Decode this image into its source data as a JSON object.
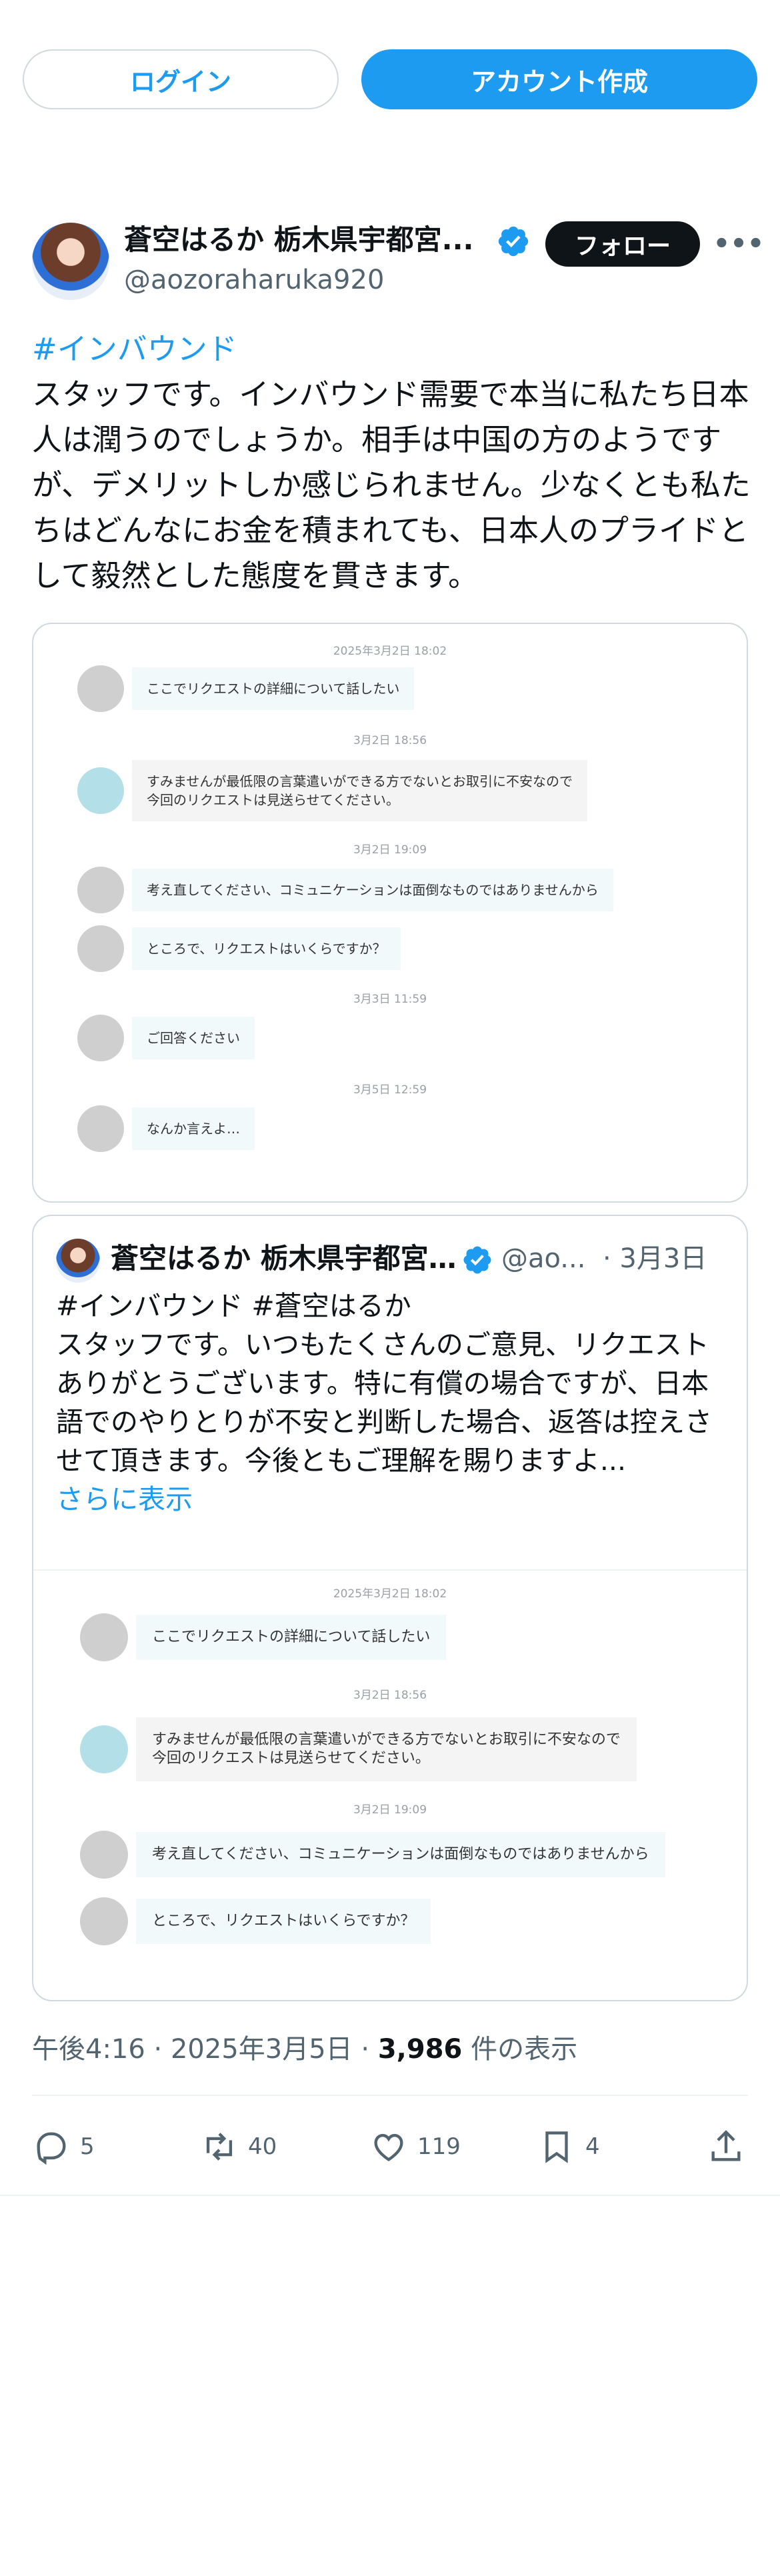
{
  "header": {
    "login_label": "ログイン",
    "signup_label": "アカウント作成"
  },
  "tweet": {
    "author_name": "蒼空はるか 栃木県宇都宮...",
    "author_handle": "@aozoraharuka920",
    "follow_label": "フォロー",
    "hashtag": "#インバウンド",
    "text": "スタッフです。インバウンド需要で本当に私たち日本人は潤うのでしょうか。相手は中国の方のようですが、デメリットしか感じられません。少なくとも私たちはどんなにお金を積まれても、日本人のプライドとして毅然とした態度を貫きます。"
  },
  "image_chat": {
    "messages": [
      {
        "timestamp": "2025年3月2日 18:02",
        "text": "ここでリクエストの詳細について話したい",
        "sender": "grey"
      },
      {
        "timestamp": "3月2日 18:56",
        "text": "すみませんが最低限の言葉遣いができる方でないとお取引に不安なので\n今回のリクエストは見送らせてください。",
        "sender": "blue"
      },
      {
        "timestamp": "3月2日 19:09",
        "text": "考え直してください、コミュニケーションは面倒なものではありませんから",
        "sender": "grey"
      },
      {
        "timestamp": "",
        "text": "ところで、リクエストはいくらですか？",
        "sender": "grey"
      },
      {
        "timestamp": "3月3日 11:59",
        "text": "ご回答ください",
        "sender": "grey"
      },
      {
        "timestamp": "3月5日 12:59",
        "text": "なんか言えよ…",
        "sender": "grey"
      }
    ]
  },
  "quote": {
    "author_name": "蒼空はるか 栃木県宇都宮...",
    "author_handle": "@ao...",
    "date": "· 3月3日",
    "hashtags": "#インバウンド #蒼空はるか",
    "text": "スタッフです。いつもたくさんのご意見、リクエストありがとうございます。特に有償の場合ですが、日本語でのやりとりが不安と判断した場合、返答は控えさせて頂きます。今後ともご理解を賜りますよ...",
    "show_more": "さらに表示",
    "chat": [
      {
        "timestamp": "2025年3月2日 18:02",
        "text": "ここでリクエストの詳細について話したい",
        "sender": "grey"
      },
      {
        "timestamp": "3月2日 18:56",
        "text": "すみませんが最低限の言葉遣いができる方でないとお取引に不安なので\n今回のリクエストは見送らせてください。",
        "sender": "blue"
      },
      {
        "timestamp": "3月2日 19:09",
        "text": "考え直してください、コミュニケーションは面倒なものではありませんから",
        "sender": "grey"
      },
      {
        "timestamp": "",
        "text": "ところで、リクエストはいくらですか？",
        "sender": "grey"
      }
    ]
  },
  "meta": {
    "time": "午後4:16",
    "date": "2025年3月5日",
    "views": "3,986",
    "views_suffix": "件の表示"
  },
  "actions": {
    "replies": "5",
    "retweets": "40",
    "likes": "119",
    "bookmarks": "4"
  },
  "colors": {
    "accent": "#1d9bf0",
    "text": "#0f1419",
    "muted": "#536471",
    "border": "#cfd9de"
  }
}
